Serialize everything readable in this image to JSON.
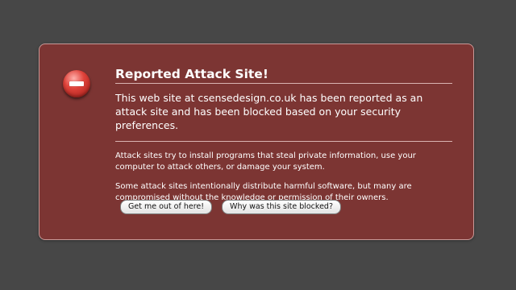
{
  "alert": {
    "icon": "stop-icon",
    "title": "Reported Attack Site!",
    "lead": "This web site at csensedesign.co.uk has been reported as an attack site and has been blocked based on your security preferences.",
    "paragraphs": [
      "Attack sites try to install programs that steal private information, use your computer to attack others, or damage your system.",
      "Some attack sites intentionally distribute harmful software, but many are compromised without the knowledge or permission of their owners."
    ],
    "buttons": {
      "get_out": "Get me out of here!",
      "why_blocked": "Why was this site blocked?"
    }
  },
  "colors": {
    "background": "#474747",
    "panel": "#7c3533",
    "panel_border": "#c99a98",
    "text": "#ffffff",
    "icon": "#d8342c"
  }
}
